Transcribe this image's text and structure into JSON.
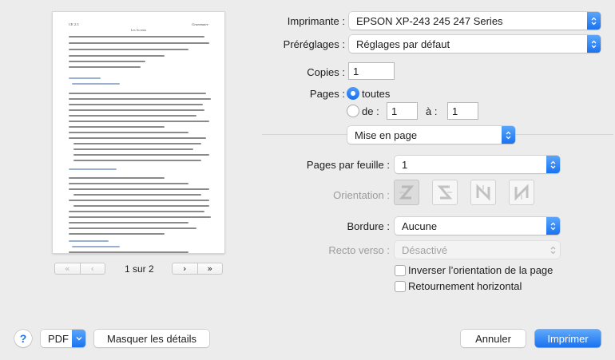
{
  "preview": {
    "header_left": "CE 2.3",
    "header_right": "Grammaire",
    "title": "Les Accents",
    "pager": {
      "first": "«",
      "prev": "‹",
      "next": "›",
      "last": "»",
      "count": "1 sur 2"
    }
  },
  "printer": {
    "label": "Imprimante :",
    "value": "EPSON XP-243 245 247 Series"
  },
  "presets": {
    "label": "Préréglages :",
    "value": "Réglages par défaut"
  },
  "copies": {
    "label": "Copies :",
    "value": "1"
  },
  "pages": {
    "label": "Pages :",
    "all_label": "toutes",
    "from_label": "de :",
    "from_value": "1",
    "to_label": "à :",
    "to_value": "1"
  },
  "section": {
    "value": "Mise en page"
  },
  "layout": {
    "pages_per_sheet_label": "Pages par feuille :",
    "pages_per_sheet_value": "1",
    "orientation_label": "Orientation :",
    "border_label": "Bordure :",
    "border_value": "Aucune",
    "duplex_label": "Recto verso :",
    "duplex_value": "Désactivé",
    "reverse_label": "Inverser l’orientation de la page",
    "flip_label": "Retournement horizontal"
  },
  "footer": {
    "help": "?",
    "pdf": "PDF",
    "hide_details": "Masquer les détails",
    "cancel": "Annuler",
    "print": "Imprimer"
  },
  "colors": {
    "accent": "#1a72ef",
    "window": "#ececec"
  }
}
